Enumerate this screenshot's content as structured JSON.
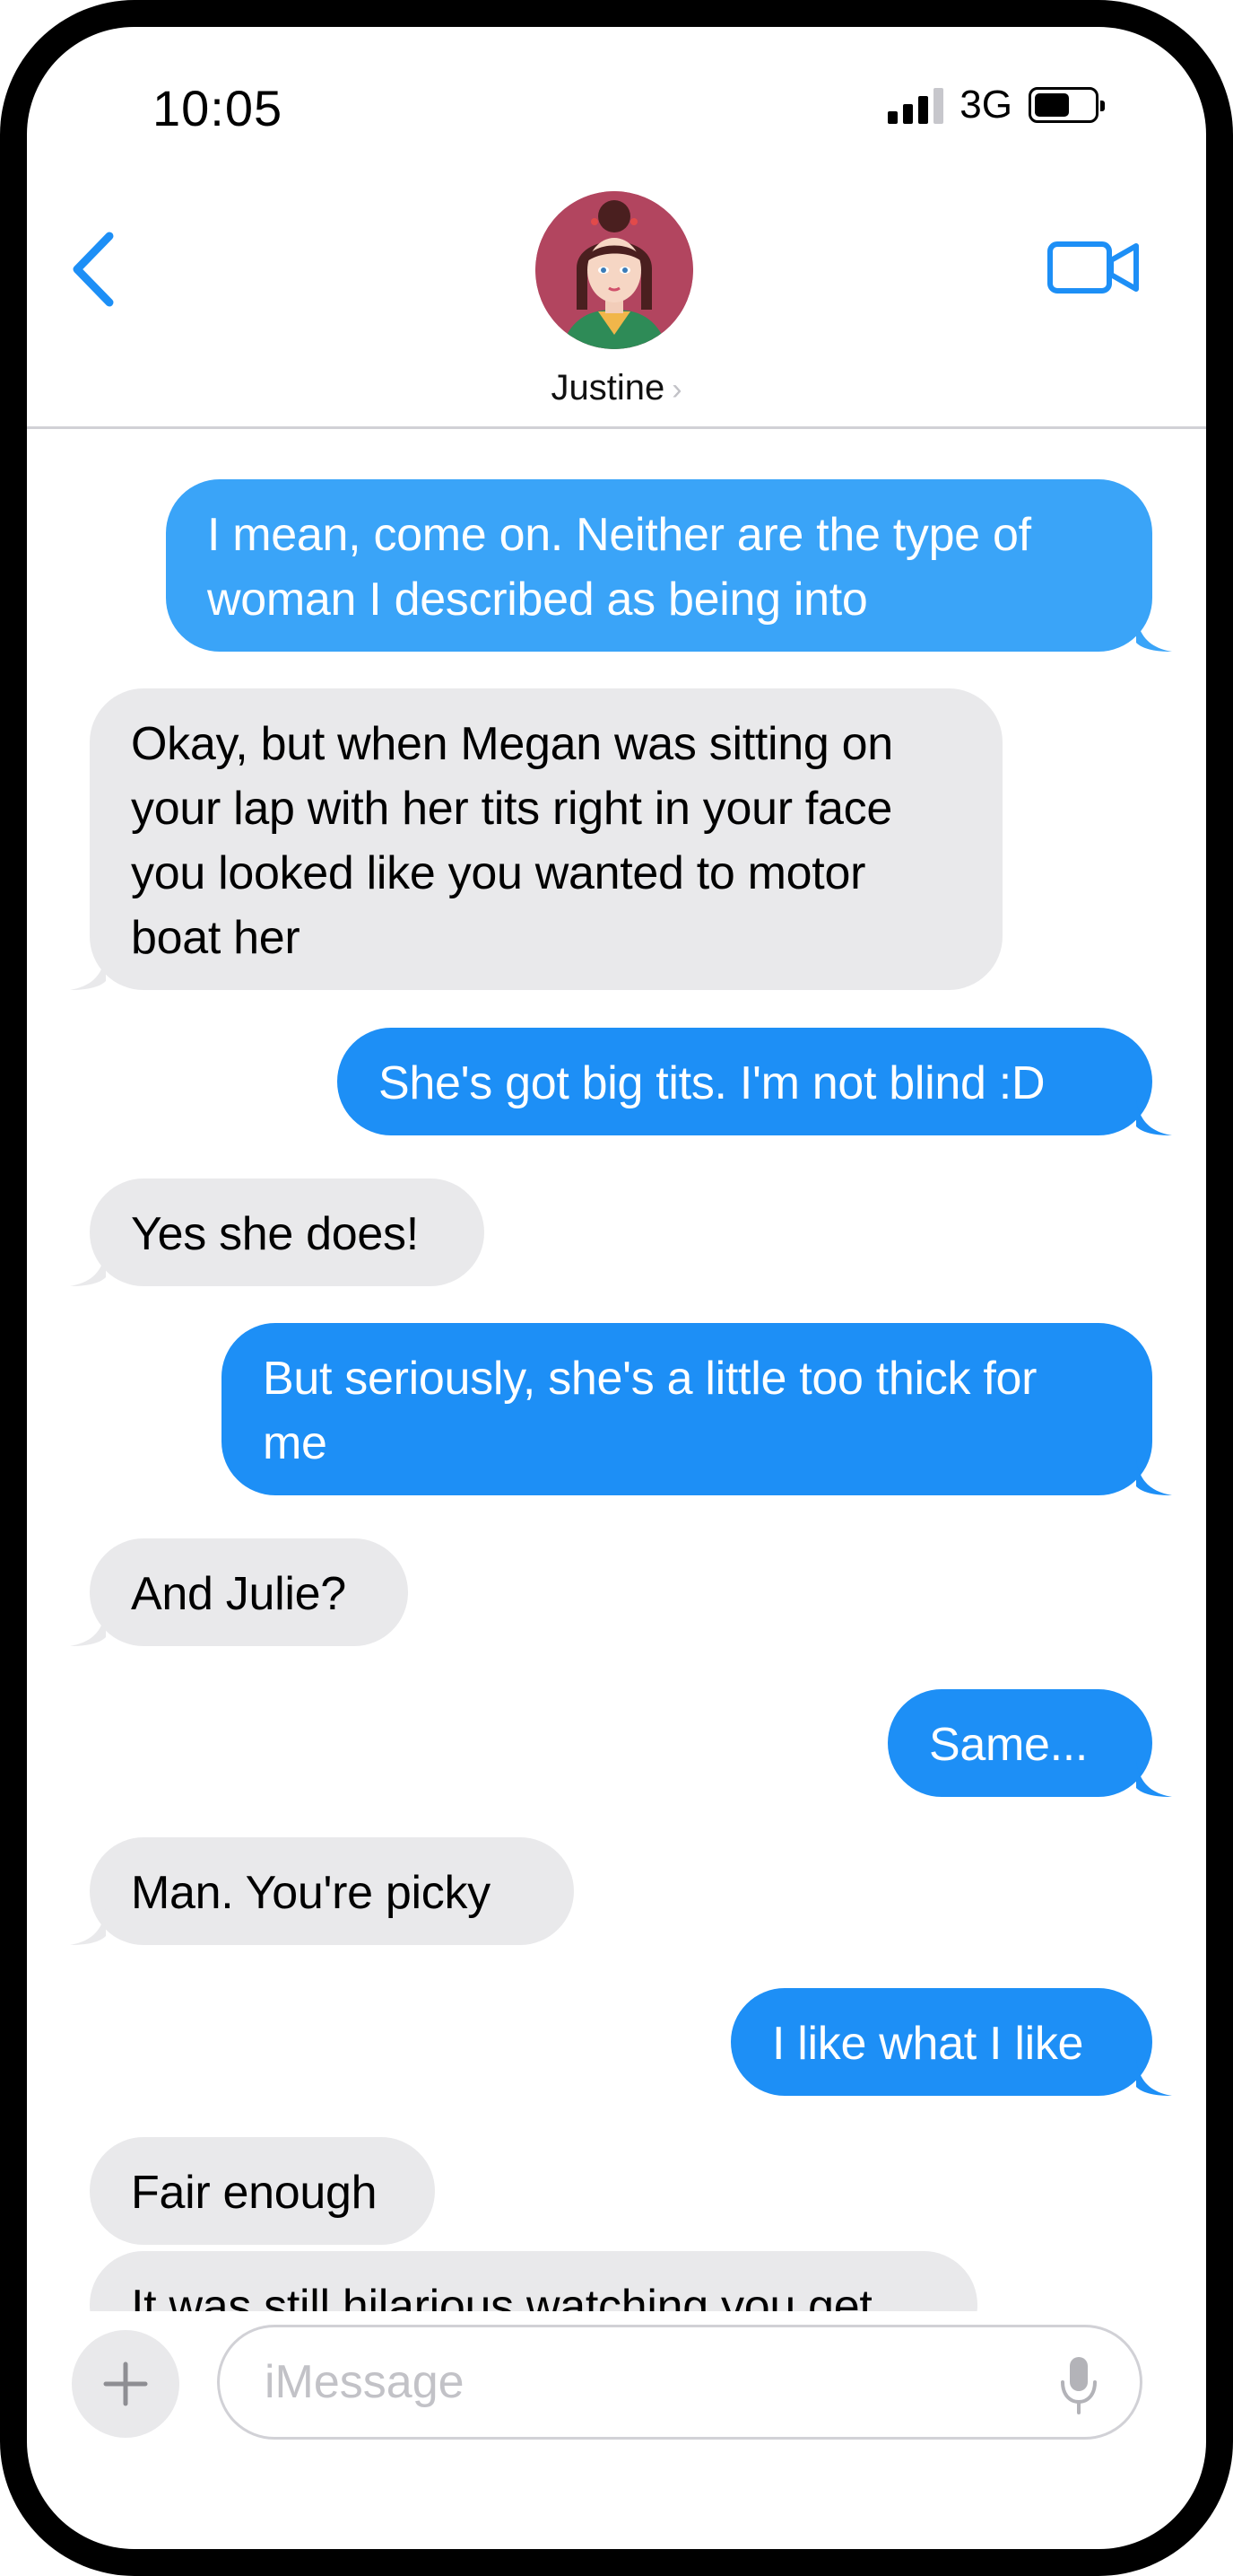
{
  "status_bar": {
    "time": "10:05",
    "network": "3G",
    "battery_level": 0.55
  },
  "header": {
    "contact_name": "Justine",
    "back_icon": "chevron-left-icon",
    "video_icon": "video-camera-icon"
  },
  "colors": {
    "sent_bubble": "#1d8ff6",
    "received_bubble": "#e9e9eb",
    "accent": "#1d8ff6"
  },
  "messages": [
    {
      "direction": "sent",
      "text": "I mean, come on.  Neither are the type of woman I described as being into"
    },
    {
      "direction": "received",
      "text": "Okay, but when Megan was sitting on your lap with her tits right in your face you looked like you wanted to motor boat her"
    },
    {
      "direction": "sent",
      "text": "She's got big tits. I'm not blind :D"
    },
    {
      "direction": "received",
      "text": "Yes she does!"
    },
    {
      "direction": "sent",
      "text": "But seriously, she's a little too thick for me"
    },
    {
      "direction": "received",
      "text": "And Julie?"
    },
    {
      "direction": "sent",
      "text": "Same..."
    },
    {
      "direction": "received",
      "text": "Man.  You're picky"
    },
    {
      "direction": "sent",
      "text": "I like what I like"
    },
    {
      "direction": "received",
      "text": "Fair enough"
    },
    {
      "direction": "received",
      "text": "It was still hilarious watching you get"
    }
  ],
  "composer": {
    "placeholder": "iMessage",
    "value": "",
    "plus_icon": "plus-icon",
    "mic_icon": "microphone-icon"
  }
}
